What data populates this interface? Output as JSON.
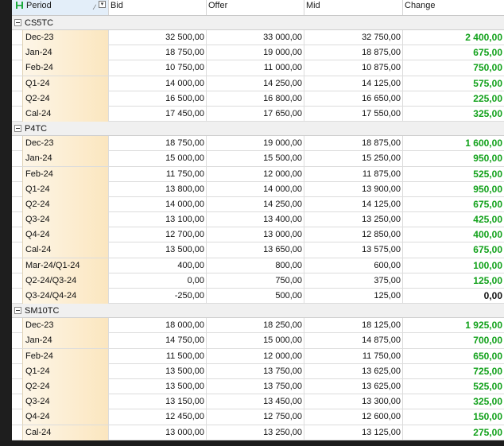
{
  "header": {
    "period": "Period",
    "bid": "Bid",
    "offer": "Offer",
    "mid": "Mid",
    "change": "Change"
  },
  "colors": {
    "positive_change": "#11a11a",
    "zero_change": "#111111",
    "header_highlight": "#e3eef9",
    "period_gradient_end": "#fbe6bf"
  },
  "groups": [
    {
      "name": "CS5TC",
      "rows": [
        {
          "period": "Dec-23",
          "bid": "32 500,00",
          "offer": "33 000,00",
          "mid": "32 750,00",
          "change": "2 400,00",
          "positive": true
        },
        {
          "period": "Jan-24",
          "bid": "18 750,00",
          "offer": "19 000,00",
          "mid": "18 875,00",
          "change": "675,00",
          "positive": true
        },
        {
          "period": "Feb-24",
          "bid": "10 750,00",
          "offer": "11 000,00",
          "mid": "10 875,00",
          "change": "750,00",
          "positive": true
        },
        {
          "period": "Q1-24",
          "bid": "14 000,00",
          "offer": "14 250,00",
          "mid": "14 125,00",
          "change": "575,00",
          "positive": true
        },
        {
          "period": "Q2-24",
          "bid": "16 500,00",
          "offer": "16 800,00",
          "mid": "16 650,00",
          "change": "225,00",
          "positive": true
        },
        {
          "period": "Cal-24",
          "bid": "17 450,00",
          "offer": "17 650,00",
          "mid": "17 550,00",
          "change": "325,00",
          "positive": true
        }
      ]
    },
    {
      "name": "P4TC",
      "rows": [
        {
          "period": "Dec-23",
          "bid": "18 750,00",
          "offer": "19 000,00",
          "mid": "18 875,00",
          "change": "1 600,00",
          "positive": true
        },
        {
          "period": "Jan-24",
          "bid": "15 000,00",
          "offer": "15 500,00",
          "mid": "15 250,00",
          "change": "950,00",
          "positive": true
        },
        {
          "period": "Feb-24",
          "bid": "11 750,00",
          "offer": "12 000,00",
          "mid": "11 875,00",
          "change": "525,00",
          "positive": true
        },
        {
          "period": "Q1-24",
          "bid": "13 800,00",
          "offer": "14 000,00",
          "mid": "13 900,00",
          "change": "950,00",
          "positive": true
        },
        {
          "period": "Q2-24",
          "bid": "14 000,00",
          "offer": "14 250,00",
          "mid": "14 125,00",
          "change": "675,00",
          "positive": true
        },
        {
          "period": "Q3-24",
          "bid": "13 100,00",
          "offer": "13 400,00",
          "mid": "13 250,00",
          "change": "425,00",
          "positive": true
        },
        {
          "period": "Q4-24",
          "bid": "12 700,00",
          "offer": "13 000,00",
          "mid": "12 850,00",
          "change": "400,00",
          "positive": true
        },
        {
          "period": "Cal-24",
          "bid": "13 500,00",
          "offer": "13 650,00",
          "mid": "13 575,00",
          "change": "675,00",
          "positive": true
        },
        {
          "period": "Mar-24/Q1-24",
          "bid": "400,00",
          "offer": "800,00",
          "mid": "600,00",
          "change": "100,00",
          "positive": true
        },
        {
          "period": "Q2-24/Q3-24",
          "bid": "0,00",
          "offer": "750,00",
          "mid": "375,00",
          "change": "125,00",
          "positive": true
        },
        {
          "period": "Q3-24/Q4-24",
          "bid": "-250,00",
          "offer": "500,00",
          "mid": "125,00",
          "change": "0,00",
          "positive": false
        }
      ]
    },
    {
      "name": "SM10TC",
      "rows": [
        {
          "period": "Dec-23",
          "bid": "18 000,00",
          "offer": "18 250,00",
          "mid": "18 125,00",
          "change": "1 925,00",
          "positive": true
        },
        {
          "period": "Jan-24",
          "bid": "14 750,00",
          "offer": "15 000,00",
          "mid": "14 875,00",
          "change": "700,00",
          "positive": true
        },
        {
          "period": "Feb-24",
          "bid": "11 500,00",
          "offer": "12 000,00",
          "mid": "11 750,00",
          "change": "650,00",
          "positive": true
        },
        {
          "period": "Q1-24",
          "bid": "13 500,00",
          "offer": "13 750,00",
          "mid": "13 625,00",
          "change": "725,00",
          "positive": true
        },
        {
          "period": "Q2-24",
          "bid": "13 500,00",
          "offer": "13 750,00",
          "mid": "13 625,00",
          "change": "525,00",
          "positive": true
        },
        {
          "period": "Q3-24",
          "bid": "13 150,00",
          "offer": "13 450,00",
          "mid": "13 300,00",
          "change": "325,00",
          "positive": true
        },
        {
          "period": "Q4-24",
          "bid": "12 450,00",
          "offer": "12 750,00",
          "mid": "12 600,00",
          "change": "150,00",
          "positive": true
        },
        {
          "period": "Cal-24",
          "bid": "13 000,00",
          "offer": "13 250,00",
          "mid": "13 125,00",
          "change": "275,00",
          "positive": true
        }
      ]
    }
  ]
}
